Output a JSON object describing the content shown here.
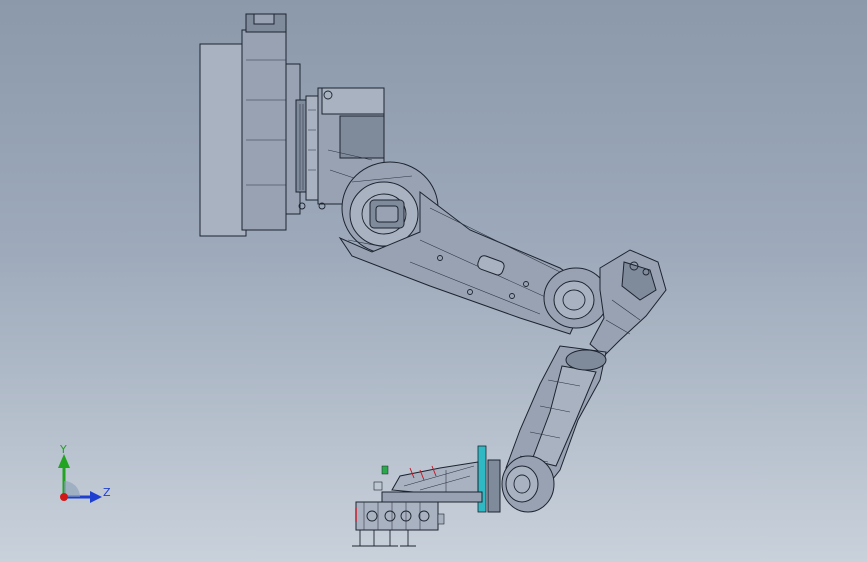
{
  "view": {
    "background_top": "#8b99ab",
    "background_bottom": "#c9d1db"
  },
  "triad": {
    "y_label": "Y",
    "z_label": "Z",
    "y_color": "#22a322",
    "z_color": "#1e3fd0",
    "x_color": "#d01818"
  },
  "model": {
    "line_color": "#1d2430",
    "accent_cyan": "#2fb9c4",
    "accent_red": "#c21d2a",
    "accent_green": "#2aa84a"
  }
}
